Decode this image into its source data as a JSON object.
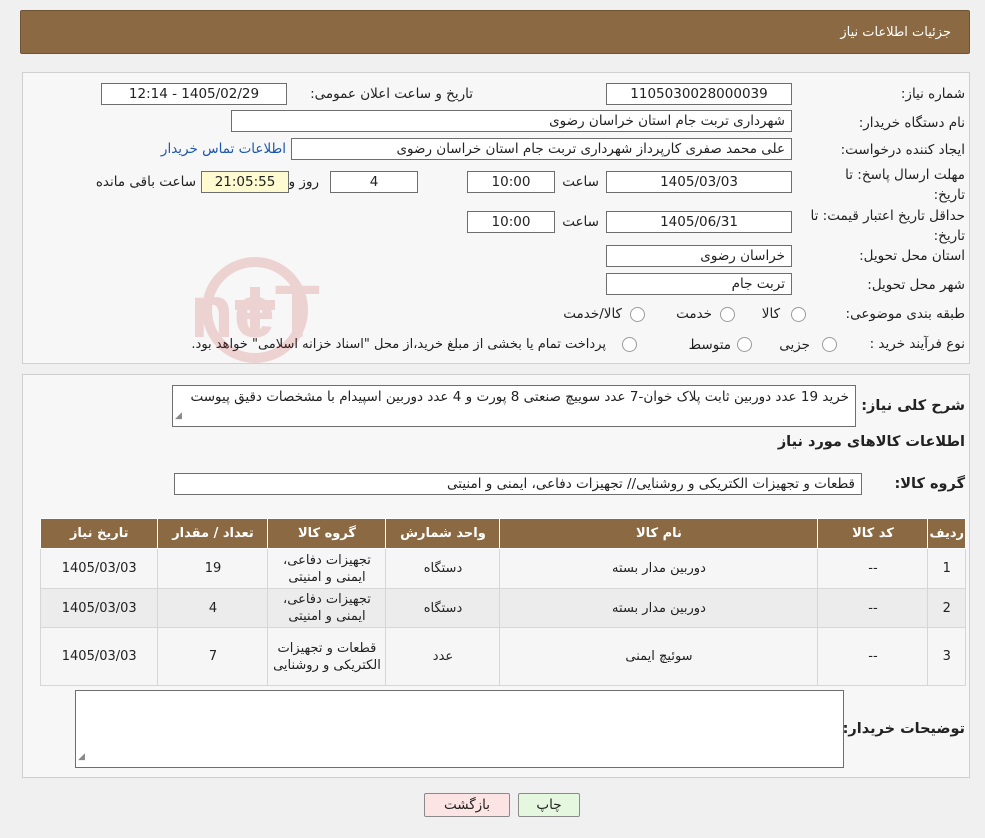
{
  "header": {
    "title": "جزئیات اطلاعات نیاز"
  },
  "info": {
    "need_number_label": "شماره نیاز:",
    "need_number": "1105030028000039",
    "announce_label": "تاریخ و ساعت اعلان عمومی:",
    "announce_value": "1405/02/29 - 12:14",
    "buyer_org_label": "نام دستگاه خریدار:",
    "buyer_org": "شهرداری تربت جام استان خراسان رضوی",
    "creator_label": "ایجاد کننده درخواست:",
    "creator": "علی محمد صفری کارپرداز شهرداری تربت جام استان خراسان رضوی",
    "contact_link": "اطلاعات تماس خریدار",
    "deadline_label": "مهلت ارسال پاسخ: تا تاریخ:",
    "deadline_date": "1405/03/03",
    "time_label": "ساعت",
    "deadline_time": "10:00",
    "days_value": "4",
    "days_label": "روز و",
    "remaining_time": "21:05:55",
    "remaining_label": "ساعت باقی مانده",
    "validity_label": "حداقل تاریخ اعتبار قیمت: تا تاریخ:",
    "validity_date": "1405/06/31",
    "validity_time": "10:00",
    "province_label": "استان محل تحویل:",
    "province": "خراسان رضوی",
    "city_label": "شهر محل تحویل:",
    "city": "تربت جام",
    "category_label": "طبقه بندی موضوعی:",
    "category_options": [
      "کالا",
      "خدمت",
      "کالا/خدمت"
    ],
    "purchase_type_label": "نوع فرآیند خرید :",
    "purchase_options": [
      "جزیی",
      "متوسط"
    ],
    "purchase_note": "پرداخت تمام یا بخشی از مبلغ خرید،از محل \"اسناد خزانه اسلامی\" خواهد بود."
  },
  "summary": {
    "desc_label": "شرح کلی نیاز:",
    "description": "خرید 19 عدد دوربین ثابت پلاک خوان-7 عدد سوییچ صنعتی 8 پورت و 4 عدد دوربین اسپیدام با مشخصات دقیق پیوست",
    "items_title": "اطلاعات کالاهای مورد نیاز",
    "group_label": "گروه کالا:",
    "group_value": "قطعات و تجهیزات الکتریکی و روشنایی// تجهیزات دفاعی، ایمنی و امنیتی",
    "table": {
      "headers": [
        "ردیف",
        "کد کالا",
        "نام کالا",
        "واحد شمارش",
        "گروه کالا",
        "تعداد / مقدار",
        "تاریخ نیاز"
      ],
      "rows": [
        [
          "1",
          "--",
          "دوربین مدار بسته",
          "دستگاه",
          "تجهیزات دفاعی، ایمنی و امنیتی",
          "19",
          "1405/03/03"
        ],
        [
          "2",
          "--",
          "دوربین مدار بسته",
          "دستگاه",
          "تجهیزات دفاعی، ایمنی و امنیتی",
          "4",
          "1405/03/03"
        ],
        [
          "3",
          "--",
          "سوئیچ ایمنی",
          "عدد",
          "قطعات و تجهیزات الکتریکی و روشنایی",
          "7",
          "1405/03/03"
        ]
      ]
    },
    "buyer_notes_label": "توضیحات خریدار:",
    "buyer_notes": ""
  },
  "buttons": {
    "print": "چاپ",
    "back": "بازگشت"
  },
  "watermark": {
    "text": "AriaTender.neT"
  },
  "colors": {
    "header_bg": "#8b6a43",
    "link": "#1a56b0",
    "timer_bg": "#fffbd0",
    "back_btn": "#fde4e4",
    "print_btn": "#e6f7df"
  }
}
